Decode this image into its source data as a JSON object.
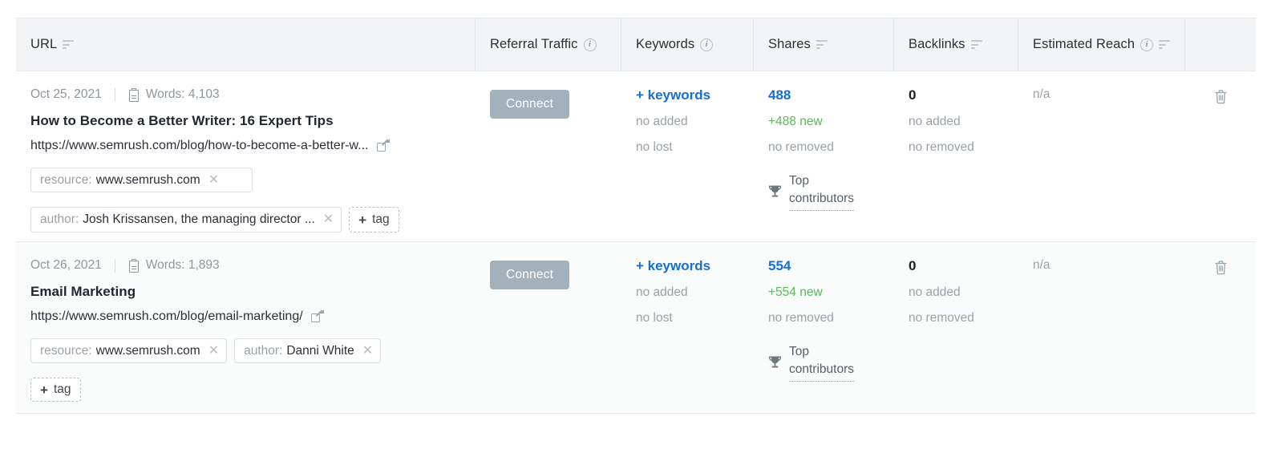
{
  "table": {
    "columns": [
      {
        "key": "url",
        "label": "URL",
        "info": false,
        "sort": true,
        "icons": [
          "sort-icon"
        ]
      },
      {
        "key": "ref",
        "label": "Referral Traffic",
        "info": true,
        "sort": false,
        "icons": [
          "info-icon"
        ]
      },
      {
        "key": "kw",
        "label": "Keywords",
        "info": true,
        "sort": false,
        "icons": [
          "info-icon"
        ]
      },
      {
        "key": "shares",
        "label": "Shares",
        "info": false,
        "sort": true,
        "icons": [
          "sort-icon"
        ]
      },
      {
        "key": "bl",
        "label": "Backlinks",
        "info": false,
        "sort": true,
        "icons": [
          "sort-icon"
        ]
      },
      {
        "key": "reach",
        "label": "Estimated Reach",
        "info": true,
        "sort": true,
        "icons": [
          "info-icon",
          "sort-icon"
        ]
      },
      {
        "key": "act",
        "label": "",
        "info": false,
        "sort": false,
        "icons": []
      }
    ],
    "rows": [
      {
        "date": "Oct 25, 2021",
        "words_label": "Words: 4,103",
        "title": "How to Become a Better Writer: 16 Expert Tips",
        "url": "https://www.semrush.com/blog/how-to-become-a-better-w...",
        "tags": [
          {
            "key": "resource:",
            "value": "www.semrush.com",
            "remove": "✕"
          },
          {
            "key": "author:",
            "value": "Josh Krissansen, the managing director ...",
            "remove": "✕"
          }
        ],
        "add_tag_label": "tag",
        "add_tag_plus": "+",
        "referral_button": "Connect",
        "keywords": {
          "link": "+ keywords",
          "added": "no added",
          "lost": "no lost"
        },
        "shares": {
          "count": "488",
          "new": "+488 new",
          "removed": "no removed",
          "contrib_line1": "Top",
          "contrib_line2": "contributors"
        },
        "backlinks": {
          "count": "0",
          "added": "no added",
          "removed": "no removed"
        },
        "estimated_reach": "n/a",
        "delete_title": "delete"
      },
      {
        "date": "Oct 26, 2021",
        "words_label": "Words: 1,893",
        "title": "Email Marketing",
        "url": "https://www.semrush.com/blog/email-marketing/",
        "tags": [
          {
            "key": "resource:",
            "value": "www.semrush.com",
            "remove": "✕"
          },
          {
            "key": "author:",
            "value": "Danni White",
            "remove": "✕"
          }
        ],
        "add_tag_label": "tag",
        "add_tag_plus": "+",
        "referral_button": "Connect",
        "keywords": {
          "link": "+ keywords",
          "added": "no added",
          "lost": "no lost"
        },
        "shares": {
          "count": "554",
          "new": "+554 new",
          "removed": "no removed",
          "contrib_line1": "Top",
          "contrib_line2": "contributors"
        },
        "backlinks": {
          "count": "0",
          "added": "no added",
          "removed": "no removed"
        },
        "estimated_reach": "n/a",
        "delete_title": "delete"
      }
    ]
  },
  "colors": {
    "header_bg": "#f2f4f5",
    "border": "#e4e8ec",
    "link_blue": "#166fd1",
    "green": "#5cb85c",
    "muted": "#9aa2a9",
    "connect_bg": "#a3b2ba",
    "alt_row_bg": "#fafbfb"
  }
}
